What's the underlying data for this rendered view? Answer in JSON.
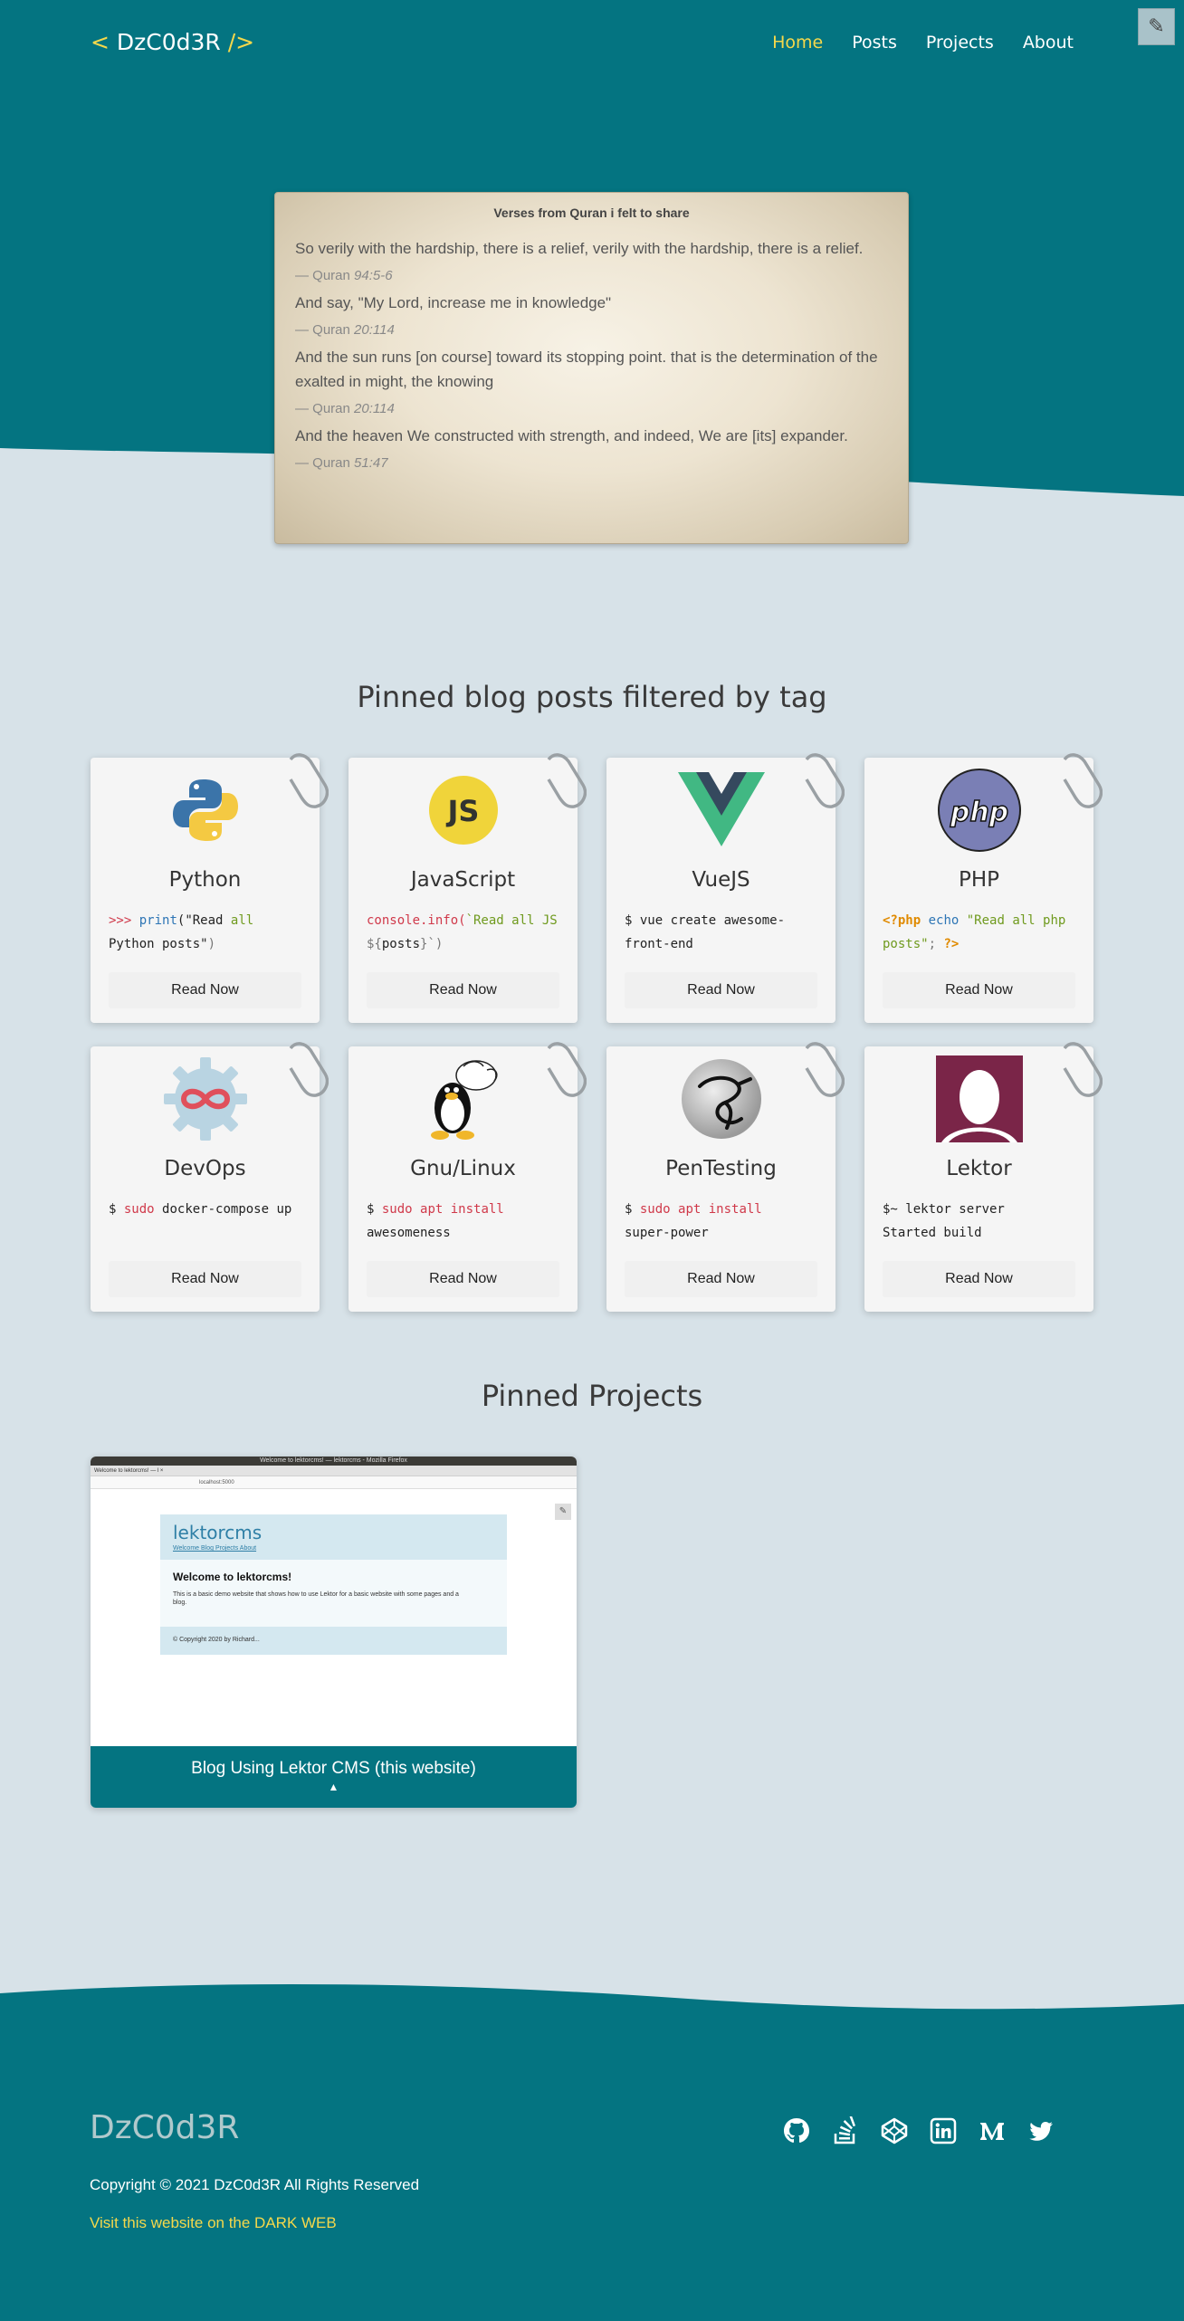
{
  "nav": {
    "brand_open": "<",
    "brand_name": "DzC0d3R",
    "brand_close": "/>",
    "links": [
      "Home",
      "Posts",
      "Projects",
      "About"
    ],
    "active": "Home",
    "edit_icon": "✎"
  },
  "quotes": {
    "title": "Verses from Quran i felt to share",
    "items": [
      {
        "text": "So verily with the hardship, there is a relief, verily with the hardship, there is a relief.",
        "source": "— Quran",
        "ref": "94:5-6"
      },
      {
        "text": "And say, \"My Lord, increase me in knowledge\"",
        "source": "— Quran",
        "ref": "20:114"
      },
      {
        "text": "And the sun runs [on course] toward its stopping point. that is the determination of the exalted in might, the knowing",
        "source": "— Quran",
        "ref": "20:114"
      },
      {
        "text": "And the heaven We constructed with strength, and indeed, We are [its] expander.",
        "source": "— Quran",
        "ref": "51:47"
      }
    ]
  },
  "posts": {
    "title": "Pinned blog posts filtered by tag",
    "button_label": "Read Now",
    "cards": [
      {
        "title": "Python",
        "icon": "python-icon"
      },
      {
        "title": "JavaScript",
        "icon": "javascript-icon"
      },
      {
        "title": "VueJS",
        "icon": "vuejs-icon"
      },
      {
        "title": "PHP",
        "icon": "php-icon"
      },
      {
        "title": "DevOps",
        "icon": "devops-icon"
      },
      {
        "title": "Gnu/Linux",
        "icon": "linux-icon"
      },
      {
        "title": "PenTesting",
        "icon": "kali-dragon-icon"
      },
      {
        "title": "Lektor",
        "icon": "lektor-icon"
      }
    ],
    "code": {
      "python": {
        "p1": ">>>",
        "p2": "print",
        "p3": "(\"Read ",
        "p4": "all",
        "p5": "Python posts\"",
        "p6": ")"
      },
      "javascript": {
        "p1": "console.info(",
        "p2": "`Read all JS ",
        "p3": "${",
        "p4": "posts",
        "p5": "}",
        "p6": "`)"
      },
      "vuejs": {
        "p1": "$ vue create awesome-front-end"
      },
      "php": {
        "p1": "<?php",
        "p2": "echo",
        "p3": "\"Read all php posts\"",
        "p4": ";",
        "p5": "?>"
      },
      "devops": {
        "p1": "$",
        "p2": "sudo",
        "p3": "docker-compose up"
      },
      "linux": {
        "p1": "$",
        "p2": "sudo apt install",
        "p3": "awesomeness"
      },
      "pentest": {
        "p1": "$",
        "p2": "sudo apt install",
        "p3": "super-power"
      },
      "lektor": {
        "p1": "$~ lektor server",
        "p2": "Started build"
      }
    }
  },
  "projects": {
    "title": "Pinned Projects",
    "items": [
      {
        "name": "Blog Using Lektor CMS (this website)",
        "caret": "▲",
        "screenshot": {
          "window_title": "Welcome to lektorcms! — lektorcms - Mozilla Firefox",
          "tab": "Welcome to lektorcms! — l  ×",
          "url": "localhost:5000",
          "logo": "lektorcms",
          "nav": "Welcome  Blog  Projects  About",
          "heading": "Welcome to lektorcms!",
          "text": "This is a basic demo website that shows how to use Lektor for a basic website with some pages and a blog.",
          "footer": "© Copyright 2020 by Richard..."
        }
      }
    ]
  },
  "footer": {
    "brand": "DzC0d3R",
    "copyright": "Copyright © 2021 DzC0d3R All Rights Reserved",
    "dark_web_link": "Visit this website on the DARK WEB",
    "socials": [
      "github-icon",
      "stackoverflow-icon",
      "codepen-icon",
      "linkedin-icon",
      "medium-icon",
      "twitter-icon"
    ]
  },
  "colors": {
    "teal": "#047481",
    "page_bg": "#d7e2e8",
    "accent_yellow": "#f5d84b"
  }
}
